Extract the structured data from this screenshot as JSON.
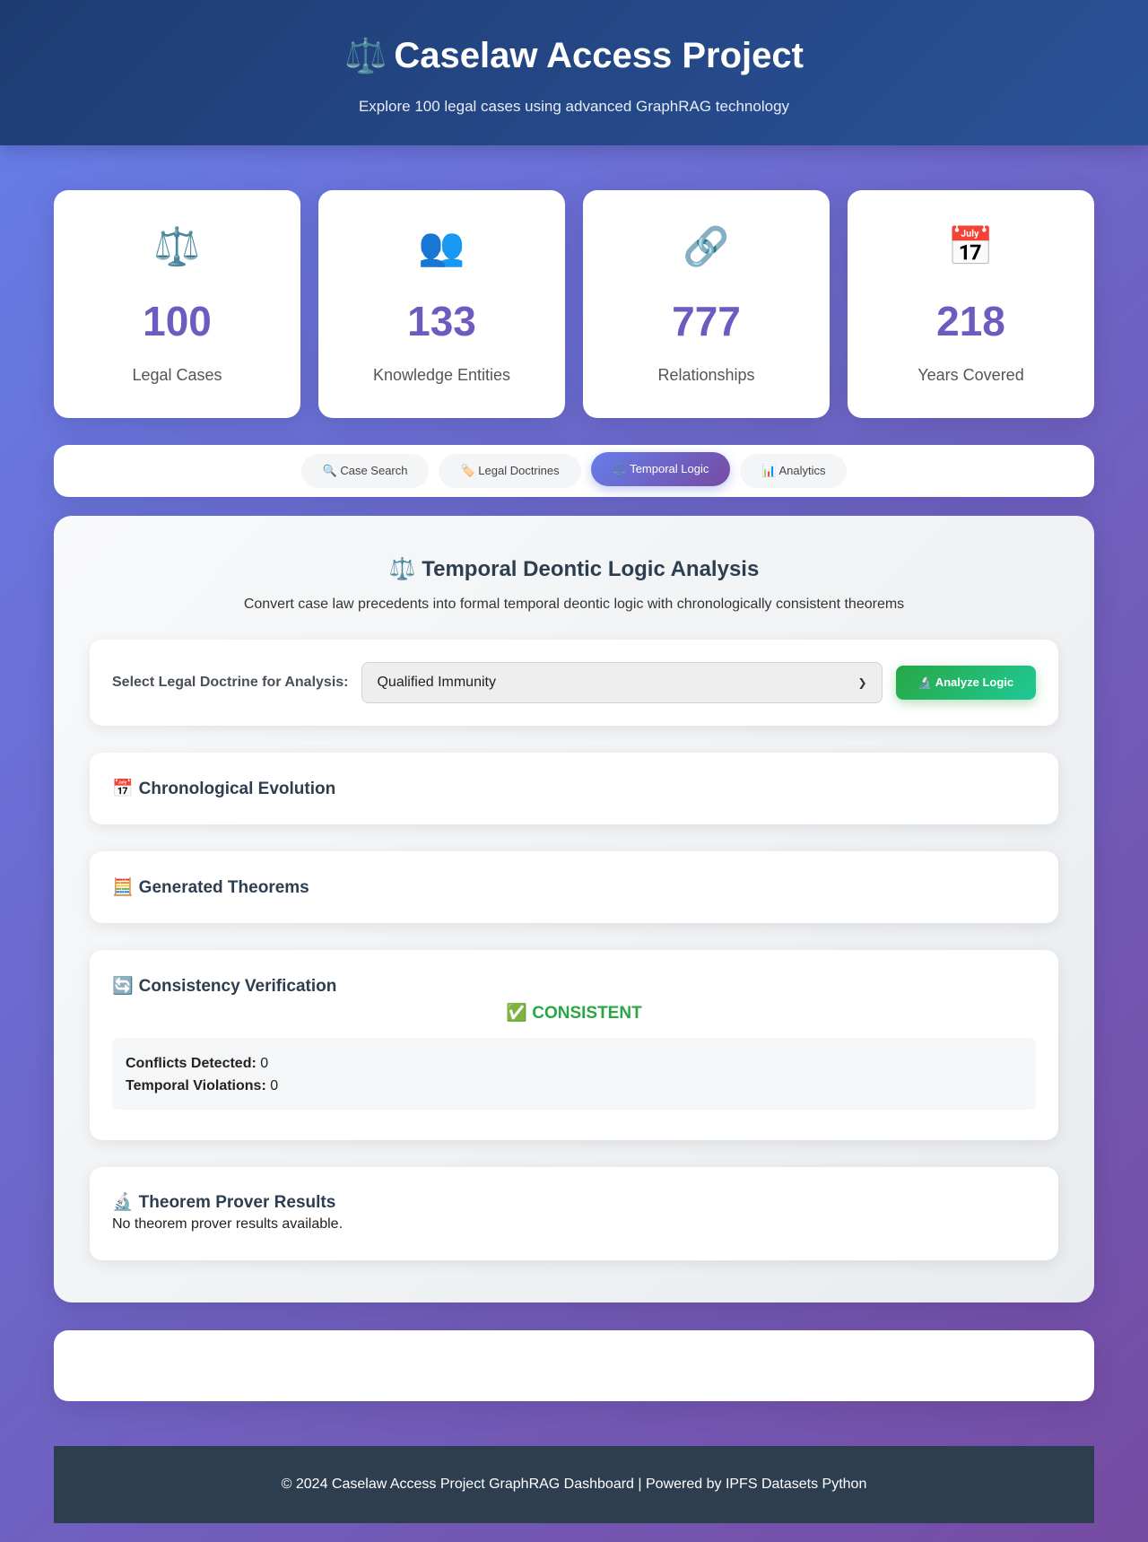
{
  "header": {
    "icon": "scales-icon",
    "icon_glyph": "⚖️",
    "title": "Caselaw Access Project",
    "subtitle": "Explore 100 legal cases using advanced GraphRAG technology"
  },
  "stats": [
    {
      "icon": "scales-icon",
      "glyph": "⚖️",
      "value": "100",
      "label": "Legal Cases"
    },
    {
      "icon": "people-icon",
      "glyph": "👥",
      "value": "133",
      "label": "Knowledge Entities"
    },
    {
      "icon": "link-icon",
      "glyph": "🔗",
      "value": "777",
      "label": "Relationships"
    },
    {
      "icon": "calendar-icon",
      "glyph": "📅",
      "value": "218",
      "label": "Years Covered"
    }
  ],
  "tabs": [
    {
      "label": "🔍 Case Search",
      "active": false
    },
    {
      "label": "🏷️ Legal Doctrines",
      "active": false
    },
    {
      "label": "⚖️ Temporal Logic",
      "active": true
    },
    {
      "label": "📊 Analytics",
      "active": false
    }
  ],
  "panel": {
    "title_icon": "⚖️",
    "title": "Temporal Deontic Logic Analysis",
    "subtitle": "Convert case law precedents into formal temporal deontic logic with chronologically consistent theorems",
    "select_label": "Select Legal Doctrine for Analysis:",
    "select_value": "Qualified Immunity",
    "analyze_button": "🔬 Analyze Logic",
    "sections": {
      "chronological": {
        "icon": "📅",
        "title": "Chronological Evolution"
      },
      "theorems": {
        "icon": "🧮",
        "title": "Generated Theorems"
      },
      "consistency": {
        "icon": "🔄",
        "title": "Consistency Verification",
        "status": "✅ CONSISTENT",
        "conflicts_label": "Conflicts Detected:",
        "conflicts_value": "0",
        "violations_label": "Temporal Violations:",
        "violations_value": "0"
      },
      "prover": {
        "icon": "🔬",
        "title": "Theorem Prover Results",
        "text": "No theorem prover results available."
      }
    }
  },
  "footer": {
    "text": "© 2024 Caselaw Access Project GraphRAG Dashboard | Powered by IPFS Datasets Python"
  },
  "colors": {
    "accent": "#6f5bc0",
    "header_bg": "#1e3c72",
    "success": "#28a745",
    "footer_bg": "#2c3e50"
  }
}
